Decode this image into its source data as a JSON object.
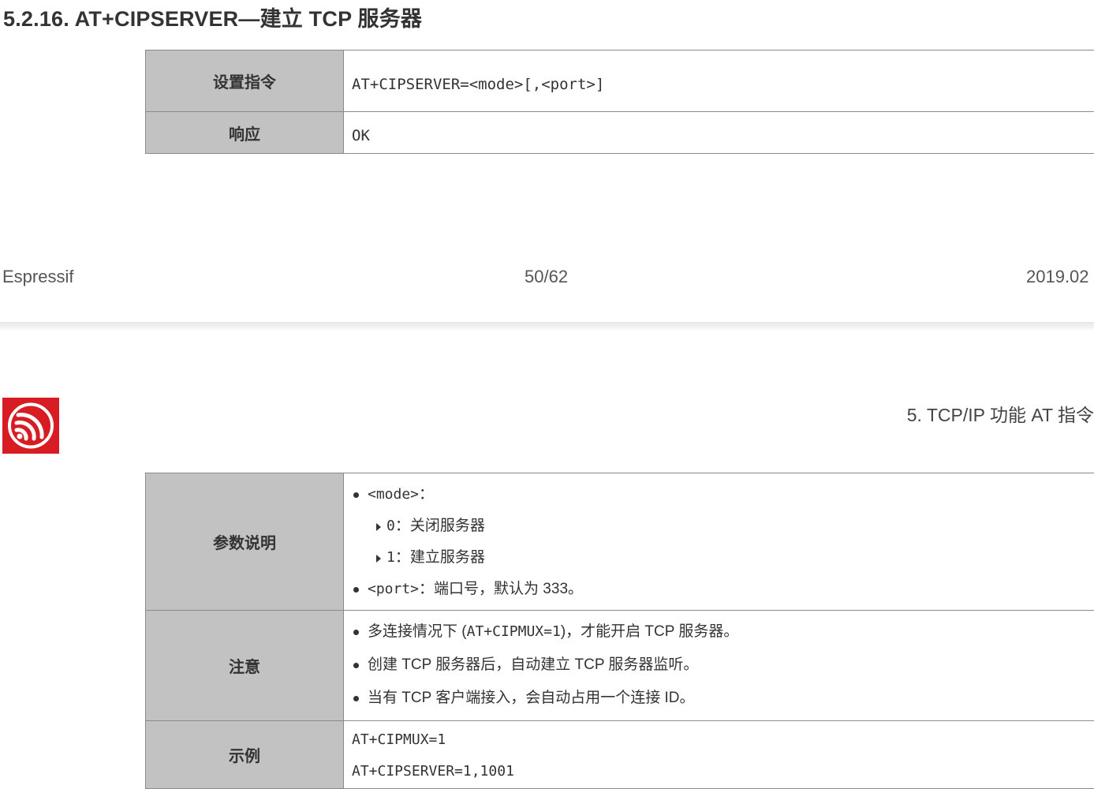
{
  "section": {
    "title": "5.2.16. AT+CIPSERVER—建立 TCP 服务器"
  },
  "table1": {
    "rows": [
      {
        "label": "设置指令",
        "value": "AT+CIPSERVER=<mode>[,<port>]"
      },
      {
        "label": "响应",
        "value": "OK"
      }
    ]
  },
  "footer": {
    "company": "Espressif",
    "page": "50/62",
    "date": "2019.02"
  },
  "header": {
    "logo": "espressif-logo-icon",
    "chapter": "5. TCP/IP 功能 AT 指令"
  },
  "table2": {
    "params": {
      "label": "参数说明",
      "mode_name": "<mode>",
      "mode_colon": "：",
      "opt0_code": "0",
      "opt0_text": "：关闭服务器",
      "opt1_code": "1",
      "opt1_text": "：建立服务器",
      "port_name": "<port>",
      "port_text": "：端口号，默认为 333。"
    },
    "notes": {
      "label": "注意",
      "note1_a": "多连接情况下 (",
      "note1_code": "AT+CIPMUX=1",
      "note1_b": ")，才能开启 TCP 服务器。",
      "note2": "创建 TCP 服务器后，自动建立 TCP 服务器监听。",
      "note3": "当有 TCP 客户端接入，会自动占用一个连接 ID。"
    },
    "example": {
      "label": "示例",
      "line1": "AT+CIPMUX=1",
      "line2": "AT+CIPSERVER=1,1001"
    }
  },
  "colors": {
    "logo_red": "#d71c24",
    "label_gray": "#c2c2c2",
    "text": "#333333"
  }
}
